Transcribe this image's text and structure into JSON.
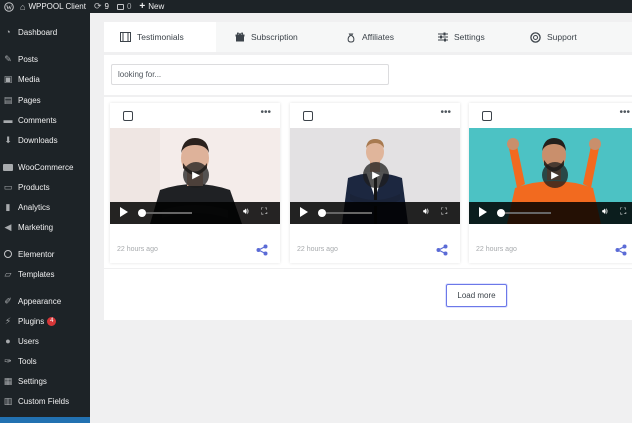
{
  "adminbar": {
    "site_name": "WPPOOL Client",
    "updates_count": "9",
    "comments_count": "0",
    "new_label": "New"
  },
  "sidebar": {
    "items": [
      {
        "label": "Dashboard",
        "icon": "dashboard-icon"
      },
      {
        "label": "Posts",
        "icon": "pin-icon"
      },
      {
        "label": "Media",
        "icon": "media-icon"
      },
      {
        "label": "Pages",
        "icon": "pages-icon"
      },
      {
        "label": "Comments",
        "icon": "comment-icon"
      },
      {
        "label": "Downloads",
        "icon": "download-icon"
      },
      {
        "label": "WooCommerce",
        "icon": "woocommerce-icon"
      },
      {
        "label": "Products",
        "icon": "archive-icon"
      },
      {
        "label": "Analytics",
        "icon": "bar-chart-icon"
      },
      {
        "label": "Marketing",
        "icon": "megaphone-icon"
      },
      {
        "label": "Elementor",
        "icon": "elementor-icon"
      },
      {
        "label": "Templates",
        "icon": "folder-icon"
      },
      {
        "label": "Appearance",
        "icon": "brush-icon"
      },
      {
        "label": "Plugins",
        "icon": "plug-icon",
        "badge": "4"
      },
      {
        "label": "Users",
        "icon": "user-icon"
      },
      {
        "label": "Tools",
        "icon": "wrench-icon"
      },
      {
        "label": "Settings",
        "icon": "settings-icon"
      },
      {
        "label": "Custom Fields",
        "icon": "table-icon"
      }
    ]
  },
  "tabs": [
    {
      "label": "Testimonials",
      "icon": "film-icon",
      "active": true
    },
    {
      "label": "Subscription",
      "icon": "gift-icon"
    },
    {
      "label": "Affiliates",
      "icon": "moneybag-icon"
    },
    {
      "label": "Settings",
      "icon": "sliders-icon"
    },
    {
      "label": "Support",
      "icon": "lifebuoy-icon"
    }
  ],
  "search": {
    "placeholder": "looking for..."
  },
  "cards": [
    {
      "time": "22 hours ago"
    },
    {
      "time": "22 hours ago"
    },
    {
      "time": "22 hours ago"
    }
  ],
  "load_more_label": "Load more",
  "colors": {
    "accent": "#2271b1",
    "adminbar": "#1d2327",
    "share": "#5b6bd6",
    "badge": "#d63638"
  }
}
